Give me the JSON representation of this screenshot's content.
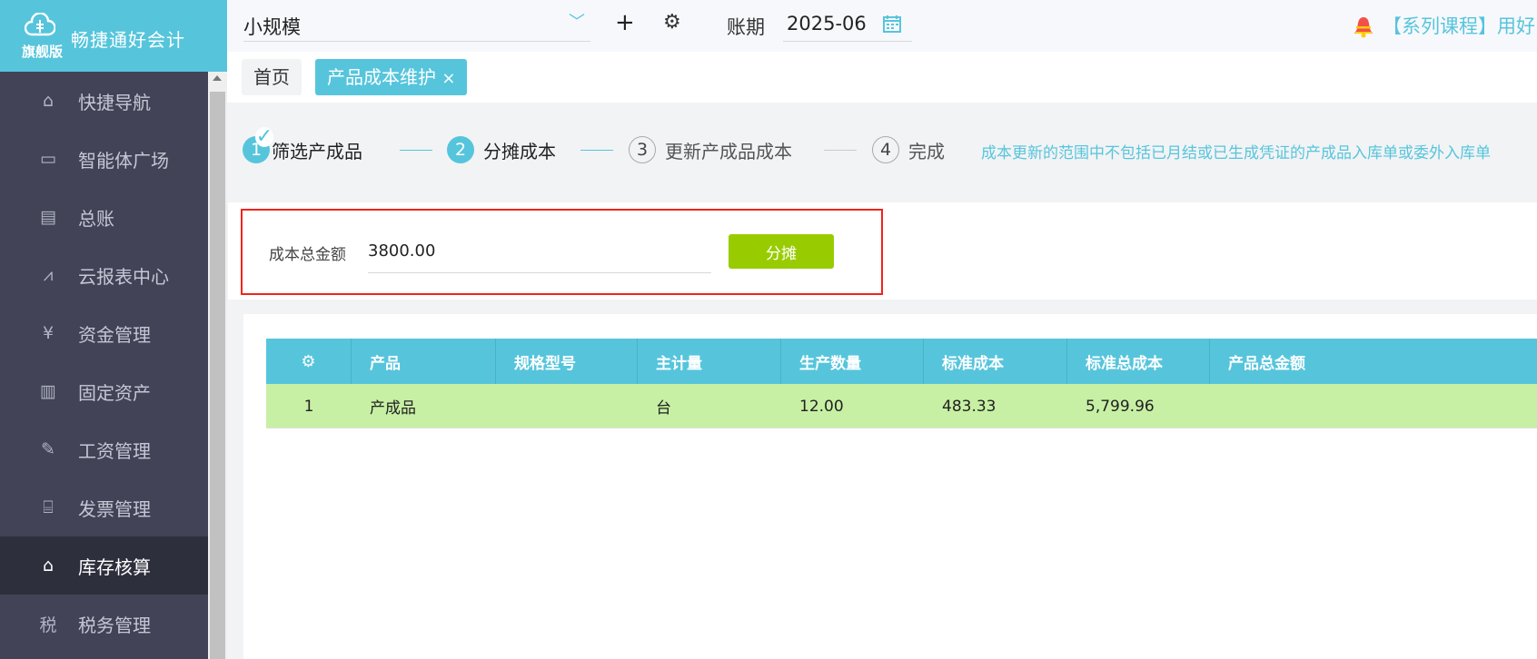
{
  "logo": {
    "title": "畅捷通好会计",
    "edition": "旗舰版"
  },
  "sidebar": {
    "items": [
      {
        "label": "快捷导航",
        "icon": "home-icon"
      },
      {
        "label": "智能体广场",
        "icon": "window-icon"
      },
      {
        "label": "总账",
        "icon": "ledger-icon"
      },
      {
        "label": "云报表中心",
        "icon": "chart-icon"
      },
      {
        "label": "资金管理",
        "icon": "money-bag-icon"
      },
      {
        "label": "固定资产",
        "icon": "building-icon"
      },
      {
        "label": "工资管理",
        "icon": "salary-icon"
      },
      {
        "label": "发票管理",
        "icon": "invoice-icon"
      },
      {
        "label": "库存核算",
        "icon": "warehouse-icon",
        "active": true
      },
      {
        "label": "税务管理",
        "icon": "tax-icon"
      }
    ]
  },
  "topbar": {
    "account_set": "小规模",
    "period_label": "账期",
    "period": "2025-06",
    "notice": "【系列课程】用好"
  },
  "tabs": [
    {
      "label": "首页"
    },
    {
      "label": "产品成本维护",
      "close": "×"
    }
  ],
  "steps": [
    {
      "num": "1",
      "label": "筛选产成品",
      "state": "done"
    },
    {
      "num": "2",
      "label": "分摊成本",
      "state": "active"
    },
    {
      "num": "3",
      "label": "更新产成品成本",
      "state": "pending"
    },
    {
      "num": "4",
      "label": "完成",
      "state": "pending"
    }
  ],
  "step_hint": "成本更新的范围中不包括已月结或已生成凭证的产成品入库单或委外入库单",
  "form": {
    "label": "成本总金额",
    "value": "3800.00",
    "button": "分摊"
  },
  "table": {
    "headers": [
      "产品",
      "规格型号",
      "主计量",
      "生产数量",
      "标准成本",
      "标准总成本",
      "产品总金额"
    ],
    "rows": [
      {
        "index": "1",
        "cells": [
          "产成品",
          "",
          "台",
          "12.00",
          "483.33",
          "5,799.96",
          ""
        ]
      }
    ]
  },
  "colors": {
    "brand": "#56c5dc",
    "sidebar": "#424357",
    "button": "#99cc00",
    "row_bg": "#c7f0a4",
    "highlight": "#f2231c"
  }
}
